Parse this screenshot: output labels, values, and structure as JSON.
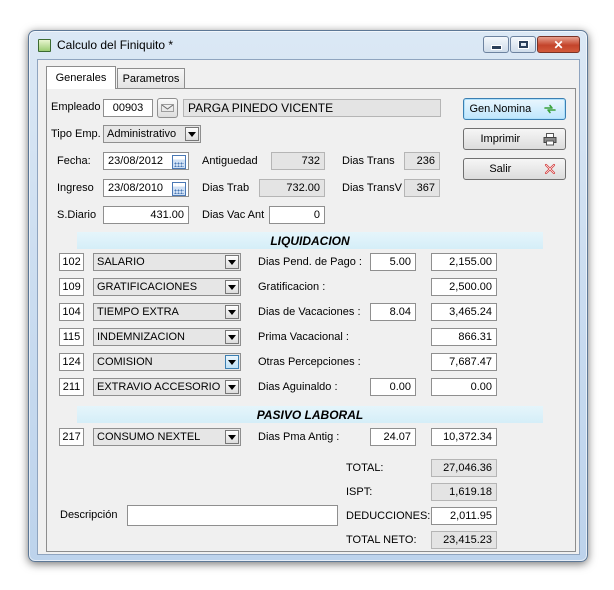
{
  "window": {
    "title": "Calculo del Finiquito *"
  },
  "tabs": [
    {
      "label": "Generales"
    },
    {
      "label": "Parametros"
    }
  ],
  "empleado": {
    "label": "Empleado",
    "code": "00903",
    "name": "PARGA PINEDO VICENTE"
  },
  "tipo_emp": {
    "label": "Tipo Emp.",
    "value": "Administrativo"
  },
  "fecha": {
    "label": "Fecha:",
    "value": "23/08/2012"
  },
  "ingreso": {
    "label": "Ingreso",
    "value": "23/08/2010"
  },
  "sdiario": {
    "label": "S.Diario",
    "value": "431.00"
  },
  "antiguedad": {
    "label": "Antiguedad",
    "value": "732"
  },
  "dias_trab": {
    "label": "Dias Trab",
    "value": "732.00"
  },
  "dias_vac_ant": {
    "label": "Dias Vac Ant",
    "value": "0"
  },
  "dias_trans": {
    "label": "Dias Trans",
    "value": "236"
  },
  "dias_transv": {
    "label": "Dias TransV",
    "value": "367"
  },
  "buttons": {
    "gen_nomina": "Gen.Nomina",
    "imprimir": "Imprimir",
    "salir": "Salir"
  },
  "liquidacion": {
    "title": "LIQUIDACION",
    "rows": [
      {
        "code": "102",
        "concept": "SALARIO",
        "label": "Dias Pend. de Pago :",
        "days": "5.00",
        "amount": "2,155.00"
      },
      {
        "code": "109",
        "concept": "GRATIFICACIONES",
        "label": "Gratificacion :",
        "days": "",
        "amount": "2,500.00"
      },
      {
        "code": "104",
        "concept": "TIEMPO EXTRA",
        "label": "Dias de Vacaciones :",
        "days": "8.04",
        "amount": "3,465.24"
      },
      {
        "code": "115",
        "concept": "INDEMNIZACION",
        "label": "Prima Vacacional :",
        "days": "",
        "amount": "866.31"
      },
      {
        "code": "124",
        "concept": "COMISION",
        "label": "Otras Percepciones :",
        "days": "",
        "amount": "7,687.47"
      },
      {
        "code": "211",
        "concept": "EXTRAVIO ACCESORIO",
        "label": "Dias Aguinaldo :",
        "days": "0.00",
        "amount": "0.00"
      }
    ]
  },
  "pasivo": {
    "title": "PASIVO LABORAL",
    "row": {
      "code": "217",
      "concept": "CONSUMO NEXTEL",
      "label": "Dias Pma Antig :",
      "days": "24.07",
      "amount": "10,372.34"
    }
  },
  "totals": {
    "total_label": "TOTAL:",
    "total": "27,046.36",
    "ispt_label": "ISPT:",
    "ispt": "1,619.18",
    "deducciones_label": "DEDUCCIONES:",
    "deducciones": "2,011.95",
    "neto_label": "TOTAL NETO:",
    "neto": "23,415.23"
  },
  "descripcion": {
    "label": "Descripción",
    "value": ""
  },
  "colors": {
    "accent_blue": "#3c7fb1",
    "section_bar": "#dff2fa",
    "close_red": "#c4442b"
  },
  "icons": [
    "app-icon",
    "envelope-icon",
    "calendar-icon",
    "refresh-arrows-icon",
    "printer-icon",
    "close-x-icon",
    "dropdown-arrow-icon"
  ]
}
